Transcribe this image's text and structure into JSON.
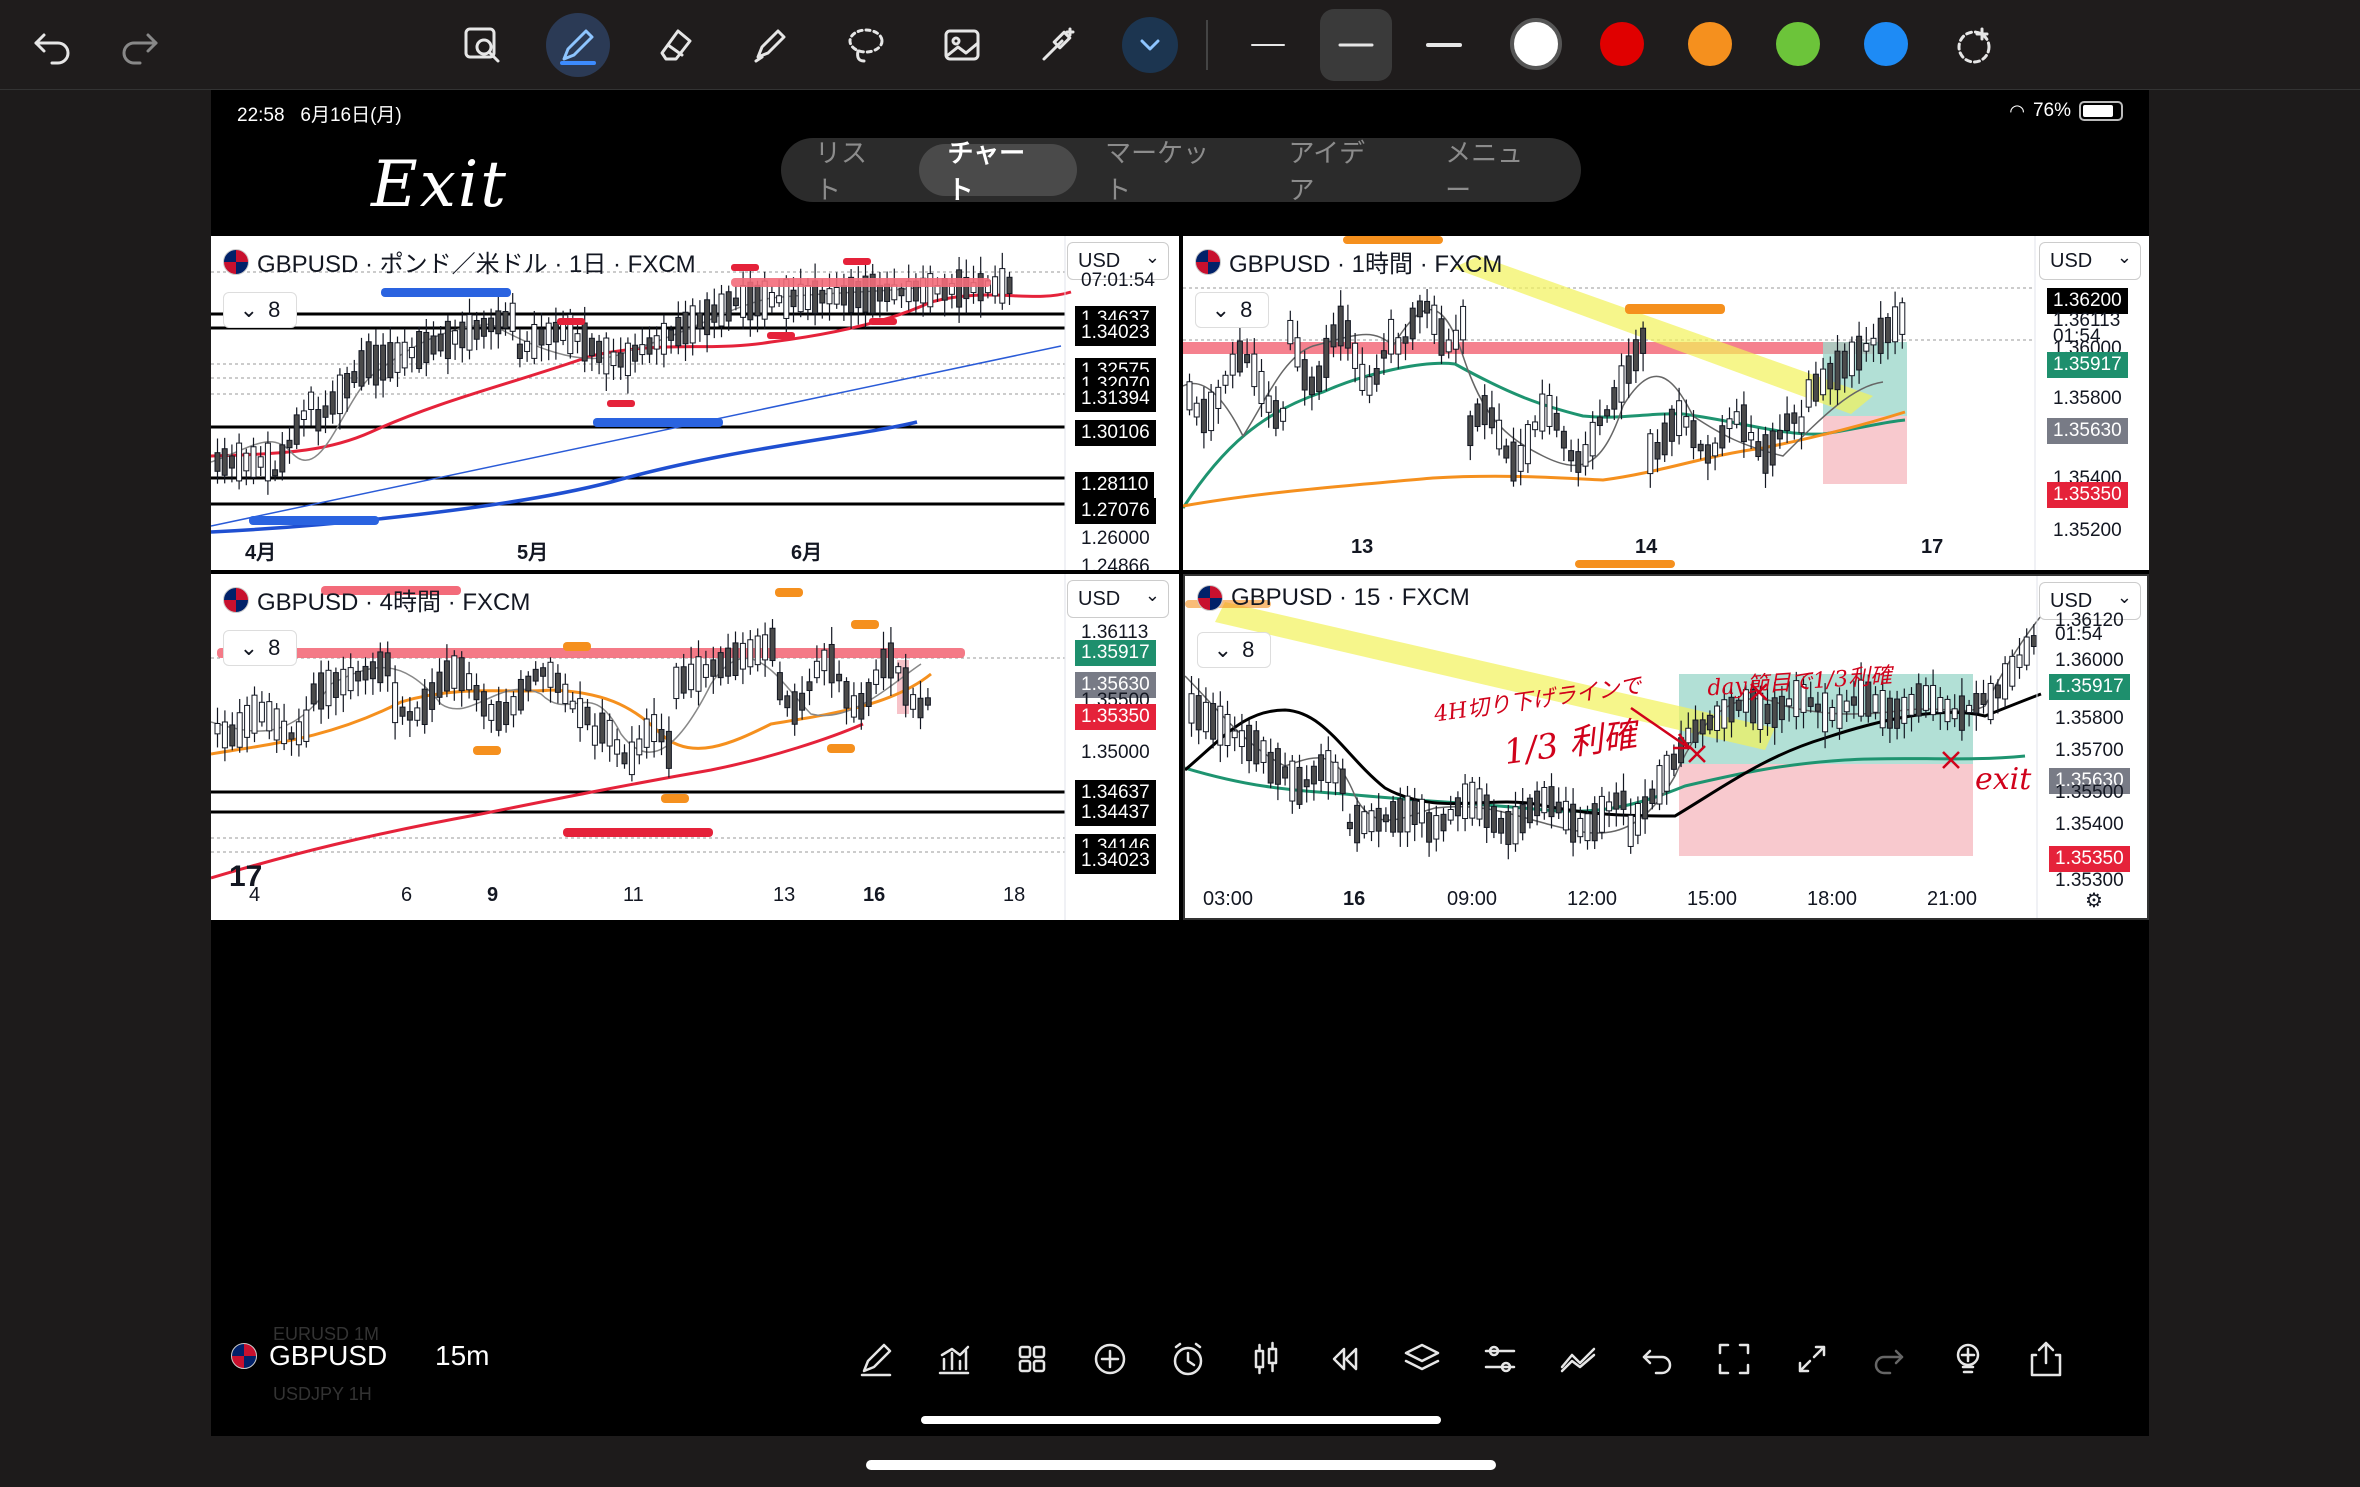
{
  "status_bar": {
    "time": "22:58",
    "date": "6月16日(月)",
    "battery": "76%"
  },
  "tabs": [
    "リスト",
    "チャート",
    "マーケット",
    "アイデア",
    "メニュー"
  ],
  "active_tab": "チャート",
  "handwriting_title": "Exit",
  "toolbar_icons": [
    "undo-icon",
    "redo-icon",
    "image-search-icon",
    "pen-icon",
    "eraser-icon",
    "highlighter-icon",
    "lasso-icon",
    "image-icon",
    "magic-wand-icon",
    "chevron-down-icon",
    "line-thin-icon",
    "line-medium-icon",
    "line-thick-icon",
    "add-color-icon"
  ],
  "pen_colors": [
    "#ffffff",
    "#e00000",
    "#f5901e",
    "#6cc43a",
    "#1e8bf5"
  ],
  "charts": {
    "daily": {
      "title": "GBPUSD · ポンド／米ドル · 1日 · FXCM",
      "indicator_count": "8",
      "currency": "USD",
      "price_labels": [
        {
          "value": "07:01:54",
          "style": "plain"
        },
        {
          "value": "1.34637",
          "style": "black"
        },
        {
          "value": "1.34023",
          "style": "black"
        },
        {
          "value": "1.32575",
          "style": "black"
        },
        {
          "value": "1.32070",
          "style": "black"
        },
        {
          "value": "1.31394",
          "style": "black"
        },
        {
          "value": "1.30106",
          "style": "black"
        },
        {
          "value": "1.28110",
          "style": "black"
        },
        {
          "value": "1.27076",
          "style": "black"
        },
        {
          "value": "1.26000",
          "style": "plain"
        },
        {
          "value": "1.24866",
          "style": "plain"
        }
      ],
      "x_labels": [
        "4月",
        "5月",
        "6月"
      ]
    },
    "h1": {
      "title": "GBPUSD · 1時間 · FXCM",
      "indicator_count": "8",
      "currency": "USD",
      "price_labels": [
        {
          "value": "1.36200",
          "style": "black"
        },
        {
          "value": "1.36113",
          "style": "plain"
        },
        {
          "value": "01:54",
          "style": "plain"
        },
        {
          "value": "1.36000",
          "style": "plain"
        },
        {
          "value": "1.35917",
          "style": "green"
        },
        {
          "value": "1.35800",
          "style": "plain"
        },
        {
          "value": "1.35630",
          "style": "gray"
        },
        {
          "value": "1.35400",
          "style": "plain"
        },
        {
          "value": "1.35350",
          "style": "red"
        },
        {
          "value": "1.35200",
          "style": "plain"
        }
      ],
      "x_labels": [
        "13",
        "14",
        "17"
      ]
    },
    "h4": {
      "title": "GBPUSD · 4時間 · FXCM",
      "indicator_count": "8",
      "currency": "USD",
      "price_labels": [
        {
          "value": "1.36113",
          "style": "plain"
        },
        {
          "value": "1.35917",
          "style": "green"
        },
        {
          "value": "1.35630",
          "style": "gray"
        },
        {
          "value": "1.35500",
          "style": "plain"
        },
        {
          "value": "1.35350",
          "style": "red"
        },
        {
          "value": "1.35000",
          "style": "plain"
        },
        {
          "value": "1.34637",
          "style": "black"
        },
        {
          "value": "1.34437",
          "style": "black"
        },
        {
          "value": "1.34146",
          "style": "black"
        },
        {
          "value": "1.34023",
          "style": "black"
        }
      ],
      "x_labels": [
        "4",
        "6",
        "9",
        "11",
        "13",
        "16",
        "18"
      ]
    },
    "m15": {
      "title": "GBPUSD · 15 · FXCM",
      "indicator_count": "8",
      "currency": "USD",
      "price_labels": [
        {
          "value": "1.36120",
          "style": "plain"
        },
        {
          "value": "01:54",
          "style": "plain"
        },
        {
          "value": "1.36000",
          "style": "plain"
        },
        {
          "value": "1.35917",
          "style": "green"
        },
        {
          "value": "1.35800",
          "style": "plain"
        },
        {
          "value": "1.35700",
          "style": "plain"
        },
        {
          "value": "1.35630",
          "style": "gray"
        },
        {
          "value": "1.35500",
          "style": "plain"
        },
        {
          "value": "1.35400",
          "style": "plain"
        },
        {
          "value": "1.35350",
          "style": "red"
        },
        {
          "value": "1.35300",
          "style": "plain"
        }
      ],
      "x_labels": [
        "03:00",
        "16",
        "09:00",
        "12:00",
        "15:00",
        "18:00",
        "21:00"
      ],
      "annotations": {
        "note1_line1": "4H切り下げラインで",
        "note1_line2": "1/3 利確",
        "note2": "day節目で1/3利確",
        "note3": "exit"
      }
    }
  },
  "bottom_bar": {
    "symbol": "GBPUSD",
    "interval": "15m",
    "ghost_top": "EURUSD   1M",
    "ghost_bottom": "USDJPY   1H",
    "icons": [
      "drawing-pen-icon",
      "indicators-icon",
      "layout-grid-icon",
      "add-icon",
      "alert-clock-icon",
      "candle-type-icon",
      "replay-icon",
      "layers-icon",
      "settings-sliders-icon",
      "compare-icon",
      "undo-icon",
      "fullscreen-icon",
      "expand-icon",
      "redo-icon",
      "idea-bulb-icon",
      "share-icon"
    ]
  }
}
